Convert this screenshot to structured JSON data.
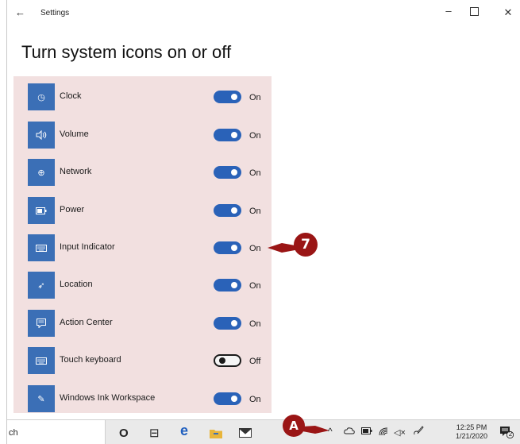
{
  "window": {
    "back_icon": "←",
    "title": "Settings",
    "minimize": "–",
    "close": "✕"
  },
  "page": {
    "heading": "Turn system icons on or off"
  },
  "items": [
    {
      "label": "Clock",
      "icon": "clock-icon",
      "glyph": "◷",
      "state": "On"
    },
    {
      "label": "Volume",
      "icon": "volume-icon",
      "glyph": "🔈",
      "state": "On"
    },
    {
      "label": "Network",
      "icon": "network-icon",
      "glyph": "⊕",
      "state": "On"
    },
    {
      "label": "Power",
      "icon": "power-icon",
      "glyph": "▭",
      "state": "On"
    },
    {
      "label": "Input Indicator",
      "icon": "keyboard-icon",
      "glyph": "⌨",
      "state": "On"
    },
    {
      "label": "Location",
      "icon": "location-icon",
      "glyph": "➶",
      "state": "On"
    },
    {
      "label": "Action Center",
      "icon": "action-center-icon",
      "glyph": "▤",
      "state": "On"
    },
    {
      "label": "Touch keyboard",
      "icon": "touch-keyboard-icon",
      "glyph": "⌨",
      "state": "Off"
    },
    {
      "label": "Windows Ink Workspace",
      "icon": "pen-icon",
      "glyph": "✎",
      "state": "On"
    }
  ],
  "callouts": {
    "step": "7",
    "letter": "A"
  },
  "taskbar": {
    "search_fragment": "ch",
    "cortana": "O",
    "task_view": "⊟",
    "edge": "e",
    "clock_time": "12:25 PM",
    "clock_date": "1/21/2020",
    "notification_count": "2",
    "tray": {
      "chevron": "^",
      "mute": "◁×"
    }
  },
  "colors": {
    "accent": "#2a62b8",
    "icon_tile": "#3b6fb6",
    "panel_highlight": "#f2e0e0",
    "callout": "#9a1515"
  }
}
